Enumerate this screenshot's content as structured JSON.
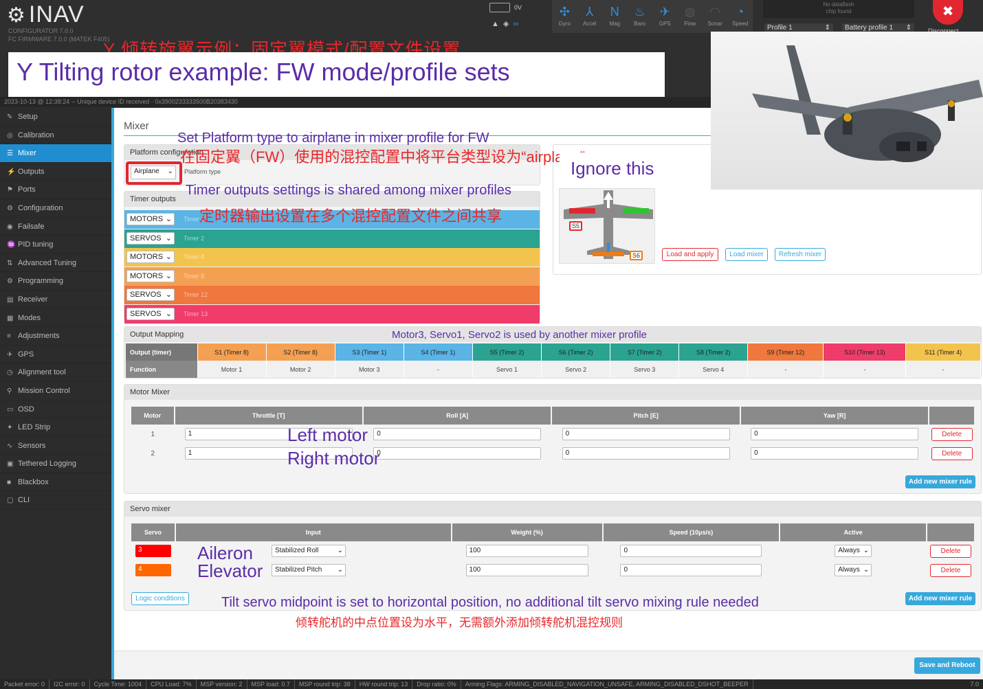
{
  "header": {
    "logo": "INAV",
    "configurator": "CONFIGURATOR  7.0.0",
    "firmware": "FC FIRMWARE     7.0.0 (MATEK F405)",
    "battery_voltage": "0V",
    "sensors": [
      {
        "label": "Gyro",
        "icon": "gyro-icon",
        "active": true
      },
      {
        "label": "Accel",
        "icon": "accel-icon",
        "active": true
      },
      {
        "label": "Mag",
        "icon": "mag-icon",
        "active": true
      },
      {
        "label": "Baro",
        "icon": "baro-icon",
        "active": true
      },
      {
        "label": "GPS",
        "icon": "gps-icon",
        "active": true
      },
      {
        "label": "Flow",
        "icon": "flow-icon",
        "active": false
      },
      {
        "label": "Sonar",
        "icon": "sonar-icon",
        "active": false
      },
      {
        "label": "Speed",
        "icon": "speed-icon",
        "active": true
      }
    ],
    "dataflash_line1": "No dataflash",
    "dataflash_line2": "chip found",
    "profile": "Profile 1",
    "battery_profile": "Battery profile 1",
    "disconnect": "Disconnect",
    "device_line": "2023-10-13 @ 12:38:24 -- Unique device ID received - 0x3900233333500B20383430"
  },
  "titles": {
    "cn": "Y 倾转旋翼示例：固定翼模式/配置文件设置",
    "en": "Y Tilting rotor example: FW mode/profile sets"
  },
  "sidebar": {
    "items": [
      {
        "label": "Setup",
        "icon": "wrench-icon"
      },
      {
        "label": "Calibration",
        "icon": "calibration-icon"
      },
      {
        "label": "Mixer",
        "icon": "mixer-icon",
        "active": true
      },
      {
        "label": "Outputs",
        "icon": "outputs-icon"
      },
      {
        "label": "Ports",
        "icon": "ports-icon"
      },
      {
        "label": "Configuration",
        "icon": "gear-icon"
      },
      {
        "label": "Failsafe",
        "icon": "failsafe-icon"
      },
      {
        "label": "PID tuning",
        "icon": "pid-icon"
      },
      {
        "label": "Advanced Tuning",
        "icon": "advanced-icon"
      },
      {
        "label": "Programming",
        "icon": "gear-icon"
      },
      {
        "label": "Receiver",
        "icon": "receiver-icon"
      },
      {
        "label": "Modes",
        "icon": "modes-icon"
      },
      {
        "label": "Adjustments",
        "icon": "adjustments-icon"
      },
      {
        "label": "GPS",
        "icon": "gps-icon"
      },
      {
        "label": "Alignment tool",
        "icon": "alignment-icon"
      },
      {
        "label": "Mission Control",
        "icon": "pin-icon"
      },
      {
        "label": "OSD",
        "icon": "osd-icon"
      },
      {
        "label": "LED Strip",
        "icon": "led-icon"
      },
      {
        "label": "Sensors",
        "icon": "sensors-icon"
      },
      {
        "label": "Tethered Logging",
        "icon": "logging-icon"
      },
      {
        "label": "Blackbox",
        "icon": "blackbox-icon"
      },
      {
        "label": "CLI",
        "icon": "cli-icon"
      }
    ]
  },
  "mixer": {
    "page_title": "Mixer",
    "platform_config": "Platform configuration",
    "platform_type_value": "Airplane",
    "platform_type_label": "Platform type",
    "timer_outputs_title": "Timer outputs",
    "timers": [
      {
        "mode": "MOTORS",
        "label": "Timer 1",
        "color": "#5ab4e5"
      },
      {
        "mode": "SERVOS",
        "label": "Timer 2",
        "color": "#2aa391"
      },
      {
        "mode": "MOTORS",
        "label": "Timer 4",
        "color": "#f2c44d"
      },
      {
        "mode": "MOTORS",
        "label": "Timer 8",
        "color": "#f4a052"
      },
      {
        "mode": "SERVOS",
        "label": "Timer 12",
        "color": "#f0773d"
      },
      {
        "mode": "SERVOS",
        "label": "Timer 13",
        "color": "#ef3c6b"
      }
    ],
    "buttons": {
      "load_apply": "Load and apply",
      "load_mixer": "Load mixer",
      "refresh_mixer": "Refresh mixer"
    },
    "diagram_labels": {
      "s5": "S5",
      "s6": "S6"
    }
  },
  "output_mapping": {
    "title": "Output Mapping",
    "row1_label": "Output (timer)",
    "row2_label": "Function",
    "outputs": [
      {
        "name": "S1 (Timer 8)",
        "func": "Motor 1",
        "color": "#f4a052"
      },
      {
        "name": "S2 (Timer 8)",
        "func": "Motor 2",
        "color": "#f4a052"
      },
      {
        "name": "S3 (Timer 1)",
        "func": "Motor 3",
        "color": "#5ab4e5"
      },
      {
        "name": "S4 (Timer 1)",
        "func": "-",
        "color": "#5ab4e5"
      },
      {
        "name": "S5 (Timer 2)",
        "func": "Servo 1",
        "color": "#2aa391"
      },
      {
        "name": "S6 (Timer 2)",
        "func": "Servo 2",
        "color": "#2aa391"
      },
      {
        "name": "S7 (Timer 2)",
        "func": "Servo 3",
        "color": "#2aa391"
      },
      {
        "name": "S8 (Timer 2)",
        "func": "Servo 4",
        "color": "#2aa391"
      },
      {
        "name": "S9 (Timer 12)",
        "func": "-",
        "color": "#f0773d"
      },
      {
        "name": "S10 (Timer 13)",
        "func": "-",
        "color": "#ef3c6b"
      },
      {
        "name": "S11 (Timer 4)",
        "func": "-",
        "color": "#f2c44d"
      }
    ]
  },
  "motor_mixer": {
    "title": "Motor Mixer",
    "headers": [
      "Motor",
      "Throttle [T]",
      "Roll [A]",
      "Pitch [E]",
      "Yaw [R]"
    ],
    "rows": [
      {
        "motor": "1",
        "throttle": "1",
        "roll": "0",
        "pitch": "0",
        "yaw": "0"
      },
      {
        "motor": "2",
        "throttle": "1",
        "roll": "0",
        "pitch": "0",
        "yaw": "0"
      }
    ],
    "delete": "Delete",
    "add_rule": "Add new mixer rule"
  },
  "servo_mixer": {
    "title": "Servo mixer",
    "headers": [
      "Servo",
      "Input",
      "Weight (%)",
      "Speed (10μs/s)",
      "Active"
    ],
    "rows": [
      {
        "servo": "3",
        "color": "#f00",
        "input": "Stabilized Roll",
        "weight": "100",
        "speed": "0",
        "active": "Always"
      },
      {
        "servo": "4",
        "color": "#f60",
        "input": "Stabilized Pitch",
        "weight": "100",
        "speed": "0",
        "active": "Always"
      }
    ],
    "delete": "Delete",
    "add_rule": "Add new mixer rule",
    "logic_conditions": "Logic conditions"
  },
  "save_reboot": "Save and Reboot",
  "annotations": {
    "platform_en": "Set Platform type to airplane in mixer  profile for FW",
    "platform_cn": "在固定翼（FW）使用的混控配置中将平台类型设为“airplane”",
    "ignore": "Ignore this",
    "timer_en": "Timer outputs settings is shared among mixer profiles",
    "timer_cn": "定时器输出设置在多个混控配置文件之间共享",
    "mapping_note": "Motor3, Servo1, Servo2  is used by another mixer profile",
    "left_motor": "Left motor",
    "right_motor": "Right motor",
    "aileron": "Aileron",
    "elevator": "Elevator",
    "tilt_en": "Tilt servo midpoint is set to horizontal position, no additional tilt servo mixing rule needed",
    "tilt_cn": "倾转舵机的中点位置设为水平，无需额外添加倾转舵机混控规则"
  },
  "statusbar": {
    "items": [
      "Packet error: 0",
      "I2C error: 0",
      "Cycle Time: 1004",
      "CPU Load: 7%",
      "MSP version: 2",
      "MSP load: 0.7",
      "MSP round trip: 38",
      "HW round trip: 13",
      "Drop ratio: 0%",
      "Arming Flags: ARMING_DISABLED_NAVIGATION_UNSAFE, ARMING_DISABLED_DSHOT_BEEPER"
    ],
    "version": "7.0"
  }
}
